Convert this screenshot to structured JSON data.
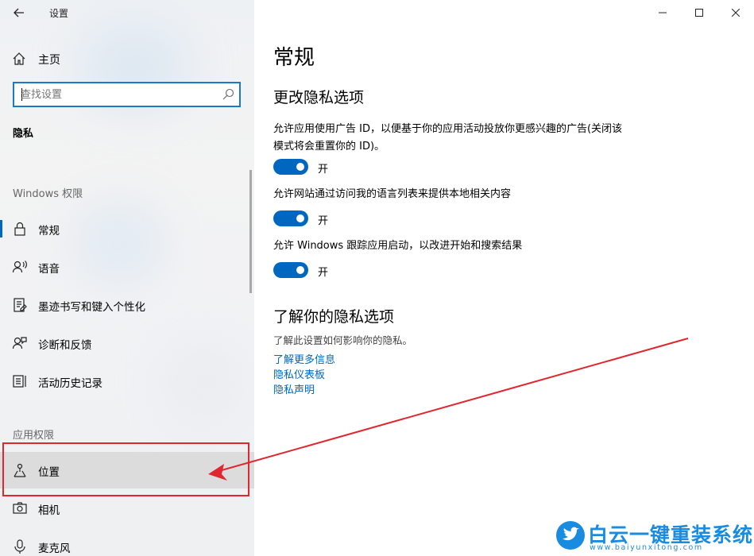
{
  "window": {
    "title": "设置",
    "controls": [
      "minimize",
      "maximize",
      "close"
    ]
  },
  "sidebar": {
    "home_label": "主页",
    "search_placeholder": "查找设置",
    "section_header": "隐私",
    "groups": [
      {
        "title": "Windows 权限",
        "items": [
          {
            "label": "常规",
            "icon": "lock-icon",
            "active": true
          },
          {
            "label": "语音",
            "icon": "speech-icon"
          },
          {
            "label": "墨迹书写和键入个性化",
            "icon": "inking-icon"
          },
          {
            "label": "诊断和反馈",
            "icon": "feedback-icon"
          },
          {
            "label": "活动历史记录",
            "icon": "activity-history-icon"
          }
        ]
      },
      {
        "title": "应用权限",
        "items": [
          {
            "label": "位置",
            "icon": "location-icon",
            "highlighted": true
          },
          {
            "label": "相机",
            "icon": "camera-icon"
          },
          {
            "label": "麦克风",
            "icon": "microphone-icon"
          }
        ]
      }
    ]
  },
  "main": {
    "page_title": "常规",
    "section1_title": "更改隐私选项",
    "settings": [
      {
        "description": "允许应用使用广告 ID，以便基于你的应用活动投放你更感兴趣的广告(关闭该模式将会重置你的 ID)。",
        "state": "开",
        "on": true
      },
      {
        "description": "允许网站通过访问我的语言列表来提供本地相关内容",
        "state": "开",
        "on": true
      },
      {
        "description": "允许 Windows 跟踪应用启动，以改进开始和搜索结果",
        "state": "开",
        "on": true
      }
    ],
    "section2_title": "了解你的隐私选项",
    "section2_desc": "了解此设置如何影响你的隐私。",
    "links": [
      "了解更多信息",
      "隐私仪表板",
      "隐私声明"
    ]
  },
  "colors": {
    "accent": "#0067c0",
    "annotation": "#e0262e",
    "watermark": "#1a8ce0"
  },
  "watermark": {
    "text": "白云一键重装系统",
    "url": "www.baiyunxitong.com"
  }
}
